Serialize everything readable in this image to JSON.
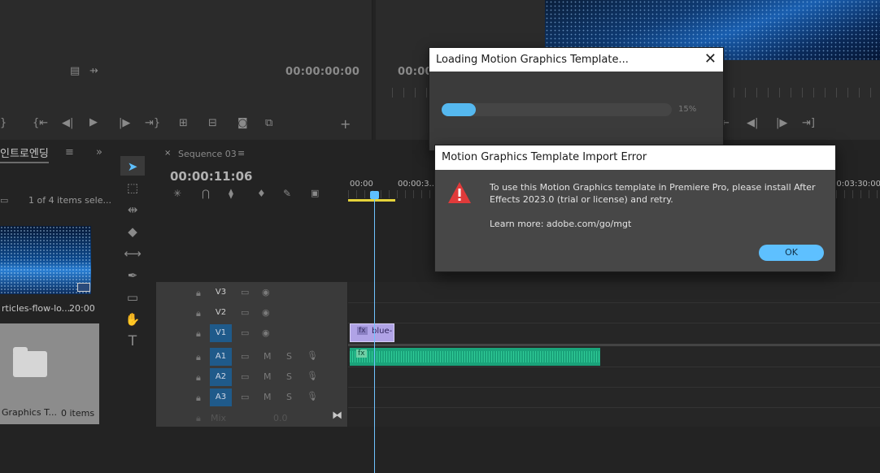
{
  "source_monitor": {
    "timecode": "00:00:00:00"
  },
  "program_monitor": {
    "timecode": "00:00"
  },
  "project_panel": {
    "tab_label": "인트로엔딩",
    "items_count": "1 of 4 items sele...",
    "clip_name": "rticles-flow-lo...",
    "clip_duration": "20:00",
    "bin_name": "Graphics T...",
    "bin_count": "0 items"
  },
  "timeline": {
    "sequence_tab": "Sequence 03",
    "timecode": "00:00:11:06",
    "ruler": [
      "00:00",
      "00:00:3...",
      "00:03:30:00"
    ],
    "tracks": {
      "video": [
        "V3",
        "V2",
        "V1"
      ],
      "audio": [
        "A1",
        "A2",
        "A3"
      ],
      "mix_label": "Mix",
      "mix_value": "0.0",
      "mute": "M",
      "solo": "S"
    },
    "video_clip_label": "blue-"
  },
  "loading_dialog": {
    "title": "Loading Motion Graphics Template...",
    "progress_percent": 15,
    "progress_text": "15%"
  },
  "error_dialog": {
    "title": "Motion Graphics Template Import Error",
    "message": "To use this Motion Graphics template in Premiere Pro, please install After Effects 2023.0 (trial or license) and retry.",
    "learn_more": "Learn more: adobe.com/go/mgt",
    "ok_label": "OK"
  },
  "colors": {
    "accent": "#5ec0ff",
    "audio_clip": "#1aa37a",
    "video_clip": "#b0a3e6",
    "warning": "#e03a3a"
  }
}
